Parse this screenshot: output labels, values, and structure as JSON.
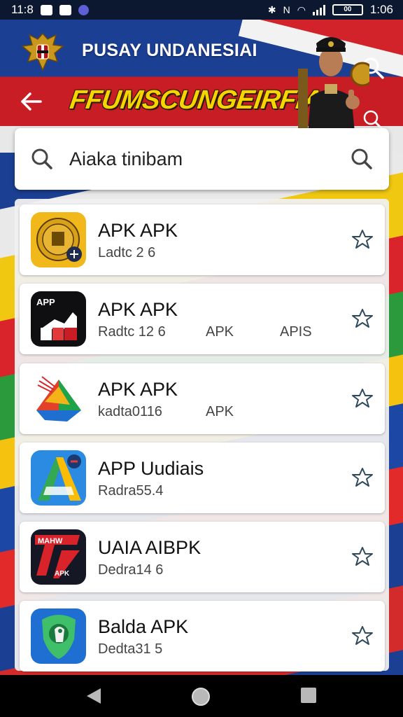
{
  "status_bar": {
    "time_left": "11:8",
    "time_right": "1:06",
    "battery_text": "00"
  },
  "header": {
    "app_title": "PUSAY UNDANESIAI",
    "promo_text": "FFUMSCUNGEIRFIA",
    "back_icon": "back-arrow-icon",
    "search_icon": "search-icon"
  },
  "search": {
    "value": "Aiaka tinibam",
    "leading_icon": "search-icon",
    "trailing_icon": "search-icon"
  },
  "apps": [
    {
      "name": "APK APK",
      "meta": "Ladtc 2 6",
      "tags": [],
      "icon": "gold-emblem-app-icon"
    },
    {
      "name": "APK APK",
      "meta": "Radtc 12 6",
      "tags": [
        "APK",
        "APIS"
      ],
      "icon": "black-chart-app-icon"
    },
    {
      "name": "APK APK",
      "meta": "kadta0116",
      "tags": [
        "APK"
      ],
      "icon": "triangle-logo-app-icon"
    },
    {
      "name": "APP Uudiais",
      "meta": "Radra55.4",
      "tags": [],
      "icon": "blue-a-app-icon"
    },
    {
      "name": "UAIA AIBPK",
      "meta": "Dedra14 6",
      "tags": [],
      "icon": "red-slash-app-icon"
    },
    {
      "name": "Balda APK",
      "meta": "Dedta31 5",
      "tags": [],
      "icon": "green-shield-app-icon"
    }
  ],
  "colors": {
    "banner_blue": "#1b3f93",
    "banner_red": "#c81d25",
    "promo_yellow": "#f6d400"
  }
}
